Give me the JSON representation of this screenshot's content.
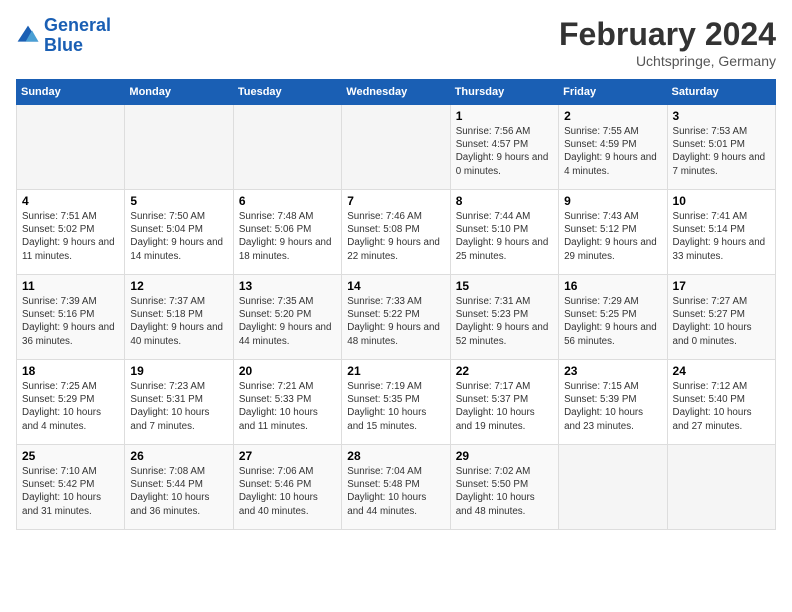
{
  "header": {
    "logo_line1": "General",
    "logo_line2": "Blue",
    "month": "February 2024",
    "location": "Uchtspringe, Germany"
  },
  "days_of_week": [
    "Sunday",
    "Monday",
    "Tuesday",
    "Wednesday",
    "Thursday",
    "Friday",
    "Saturday"
  ],
  "weeks": [
    [
      {
        "day": "",
        "content": ""
      },
      {
        "day": "",
        "content": ""
      },
      {
        "day": "",
        "content": ""
      },
      {
        "day": "",
        "content": ""
      },
      {
        "day": "1",
        "content": "Sunrise: 7:56 AM\nSunset: 4:57 PM\nDaylight: 9 hours and 0 minutes."
      },
      {
        "day": "2",
        "content": "Sunrise: 7:55 AM\nSunset: 4:59 PM\nDaylight: 9 hours and 4 minutes."
      },
      {
        "day": "3",
        "content": "Sunrise: 7:53 AM\nSunset: 5:01 PM\nDaylight: 9 hours and 7 minutes."
      }
    ],
    [
      {
        "day": "4",
        "content": "Sunrise: 7:51 AM\nSunset: 5:02 PM\nDaylight: 9 hours and 11 minutes."
      },
      {
        "day": "5",
        "content": "Sunrise: 7:50 AM\nSunset: 5:04 PM\nDaylight: 9 hours and 14 minutes."
      },
      {
        "day": "6",
        "content": "Sunrise: 7:48 AM\nSunset: 5:06 PM\nDaylight: 9 hours and 18 minutes."
      },
      {
        "day": "7",
        "content": "Sunrise: 7:46 AM\nSunset: 5:08 PM\nDaylight: 9 hours and 22 minutes."
      },
      {
        "day": "8",
        "content": "Sunrise: 7:44 AM\nSunset: 5:10 PM\nDaylight: 9 hours and 25 minutes."
      },
      {
        "day": "9",
        "content": "Sunrise: 7:43 AM\nSunset: 5:12 PM\nDaylight: 9 hours and 29 minutes."
      },
      {
        "day": "10",
        "content": "Sunrise: 7:41 AM\nSunset: 5:14 PM\nDaylight: 9 hours and 33 minutes."
      }
    ],
    [
      {
        "day": "11",
        "content": "Sunrise: 7:39 AM\nSunset: 5:16 PM\nDaylight: 9 hours and 36 minutes."
      },
      {
        "day": "12",
        "content": "Sunrise: 7:37 AM\nSunset: 5:18 PM\nDaylight: 9 hours and 40 minutes."
      },
      {
        "day": "13",
        "content": "Sunrise: 7:35 AM\nSunset: 5:20 PM\nDaylight: 9 hours and 44 minutes."
      },
      {
        "day": "14",
        "content": "Sunrise: 7:33 AM\nSunset: 5:22 PM\nDaylight: 9 hours and 48 minutes."
      },
      {
        "day": "15",
        "content": "Sunrise: 7:31 AM\nSunset: 5:23 PM\nDaylight: 9 hours and 52 minutes."
      },
      {
        "day": "16",
        "content": "Sunrise: 7:29 AM\nSunset: 5:25 PM\nDaylight: 9 hours and 56 minutes."
      },
      {
        "day": "17",
        "content": "Sunrise: 7:27 AM\nSunset: 5:27 PM\nDaylight: 10 hours and 0 minutes."
      }
    ],
    [
      {
        "day": "18",
        "content": "Sunrise: 7:25 AM\nSunset: 5:29 PM\nDaylight: 10 hours and 4 minutes."
      },
      {
        "day": "19",
        "content": "Sunrise: 7:23 AM\nSunset: 5:31 PM\nDaylight: 10 hours and 7 minutes."
      },
      {
        "day": "20",
        "content": "Sunrise: 7:21 AM\nSunset: 5:33 PM\nDaylight: 10 hours and 11 minutes."
      },
      {
        "day": "21",
        "content": "Sunrise: 7:19 AM\nSunset: 5:35 PM\nDaylight: 10 hours and 15 minutes."
      },
      {
        "day": "22",
        "content": "Sunrise: 7:17 AM\nSunset: 5:37 PM\nDaylight: 10 hours and 19 minutes."
      },
      {
        "day": "23",
        "content": "Sunrise: 7:15 AM\nSunset: 5:39 PM\nDaylight: 10 hours and 23 minutes."
      },
      {
        "day": "24",
        "content": "Sunrise: 7:12 AM\nSunset: 5:40 PM\nDaylight: 10 hours and 27 minutes."
      }
    ],
    [
      {
        "day": "25",
        "content": "Sunrise: 7:10 AM\nSunset: 5:42 PM\nDaylight: 10 hours and 31 minutes."
      },
      {
        "day": "26",
        "content": "Sunrise: 7:08 AM\nSunset: 5:44 PM\nDaylight: 10 hours and 36 minutes."
      },
      {
        "day": "27",
        "content": "Sunrise: 7:06 AM\nSunset: 5:46 PM\nDaylight: 10 hours and 40 minutes."
      },
      {
        "day": "28",
        "content": "Sunrise: 7:04 AM\nSunset: 5:48 PM\nDaylight: 10 hours and 44 minutes."
      },
      {
        "day": "29",
        "content": "Sunrise: 7:02 AM\nSunset: 5:50 PM\nDaylight: 10 hours and 48 minutes."
      },
      {
        "day": "",
        "content": ""
      },
      {
        "day": "",
        "content": ""
      }
    ]
  ]
}
